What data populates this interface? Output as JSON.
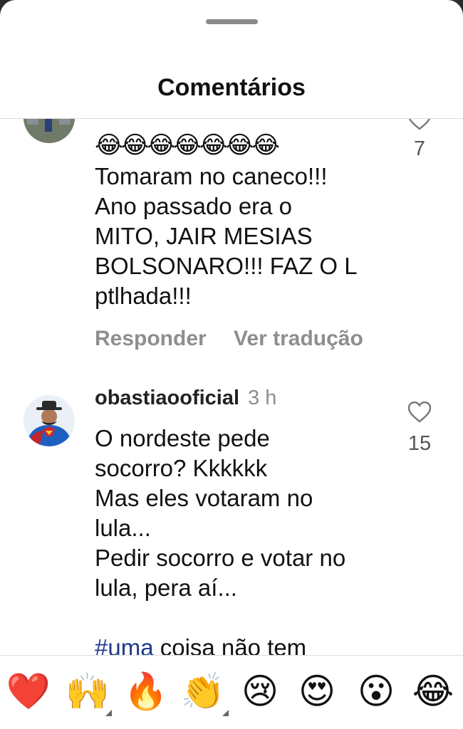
{
  "header": {
    "title": "Comentários"
  },
  "comment1": {
    "emojis": "😂😂😂😂😂😂😂",
    "text": "Tomaram no caneco!!!\nAno passado era o\nMITO, JAIR MESIAS\nBOLSONARO!!! FAZ O L\nptlhada!!!",
    "likes": "7",
    "reply_label": "Responder",
    "translate_label": "Ver tradução"
  },
  "comment2": {
    "username": "obastiaooficial",
    "time": "3 h",
    "text": "O nordeste pede\nsocorro? Kkkkkk\nMas eles votaram no\nlula...\nPedir socorro e votar no\nlula, pera aí...",
    "hashtag": "#uma",
    "text_after_hashtag": " coisa não tem",
    "likes": "15"
  },
  "reactions": [
    {
      "icon": "red-heart-icon",
      "glyph": "❤️"
    },
    {
      "icon": "raising-hands-icon",
      "glyph": "🙌"
    },
    {
      "icon": "fire-icon",
      "glyph": "🔥"
    },
    {
      "icon": "clapping-hands-icon",
      "glyph": "👏"
    },
    {
      "icon": "crying-face-icon",
      "glyph": "😢"
    },
    {
      "icon": "heart-eyes-icon",
      "glyph": "😍"
    },
    {
      "icon": "astonished-face-icon",
      "glyph": "😮"
    },
    {
      "icon": "tears-of-joy-icon",
      "glyph": "😂"
    }
  ],
  "colors": {
    "hashtag": "#1e3a8a",
    "secondary_text": "#8e8e8e"
  }
}
